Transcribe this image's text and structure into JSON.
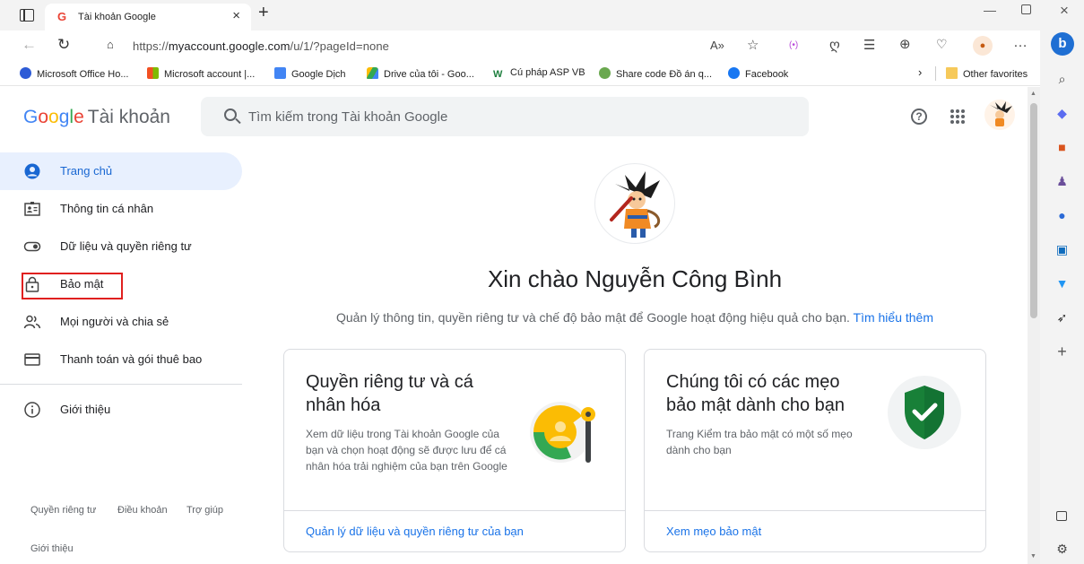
{
  "browser": {
    "tab_title": "Tài khoản Google",
    "tab_favicon": "G",
    "url_prefix": "https://",
    "url_domain": "myaccount.google.com",
    "url_path": "/u/1/?pageId=none",
    "new_tab_symbol": "+",
    "favorites": [
      {
        "label": "Microsoft Office Ho...",
        "icon": "office-icon",
        "color": "#2d5bd6"
      },
      {
        "label": "Microsoft account |...",
        "icon": "microsoft-icon",
        "color": "#f25022"
      },
      {
        "label": "Google Dịch",
        "icon": "translate-icon",
        "color": "#4285f4"
      },
      {
        "label": "Drive của tôi - Goo...",
        "icon": "drive-icon",
        "color": "#34a853"
      },
      {
        "label": "Cú pháp ASP VB",
        "icon": "w3-icon",
        "color": "#1d7f3e"
      },
      {
        "label": "Share code Đồ án q...",
        "icon": "share-code-icon",
        "color": "#6aa84f"
      },
      {
        "label": "Facebook",
        "icon": "facebook-icon",
        "color": "#1877f2"
      }
    ],
    "other_favorites": "Other favorites"
  },
  "header": {
    "logo_google": [
      "G",
      "o",
      "o",
      "g",
      "l",
      "e"
    ],
    "logo_account": "Tài khoản",
    "search_placeholder": "Tìm kiếm trong Tài khoản Google",
    "help_symbol": "?"
  },
  "nav": {
    "items": [
      {
        "label": "Trang chủ",
        "icon": "home-icon",
        "active": true
      },
      {
        "label": "Thông tin cá nhân",
        "icon": "id-card-icon"
      },
      {
        "label": "Dữ liệu và quyền riêng tư",
        "icon": "toggle-icon"
      },
      {
        "label": "Bảo mật",
        "icon": "lock-icon"
      },
      {
        "label": "Mọi người và chia sẻ",
        "icon": "people-icon"
      },
      {
        "label": "Thanh toán và gói thuê bao",
        "icon": "credit-card-icon"
      },
      {
        "label": "Giới thiệu",
        "icon": "info-icon"
      }
    ],
    "footer": {
      "privacy": "Quyền riêng tư",
      "terms": "Điều khoản",
      "help": "Trợ giúp",
      "about": "Giới thiệu"
    }
  },
  "main": {
    "greeting": "Xin chào Nguyễn Công Bình",
    "subtitle": "Quản lý thông tin, quyền riêng tư và chế độ bảo mật để Google hoạt động hiệu quả cho bạn.",
    "learn_more": "Tìm hiểu thêm",
    "cards": [
      {
        "title": "Quyền riêng tư và cá nhân hóa",
        "desc": "Xem dữ liệu trong Tài khoản Google của bạn và chọn hoạt động sẽ được lưu để cá nhân hóa trải nghiệm của bạn trên Google",
        "link": "Quản lý dữ liệu và quyền riêng tư của bạn"
      },
      {
        "title": "Chúng tôi có các mẹo bảo mật dành cho bạn",
        "desc": "Trang Kiểm tra bảo mật có một số mẹo dành cho bạn",
        "link": "Xem mẹo bảo mật"
      }
    ]
  },
  "colors": {
    "accent": "#1a73e8",
    "active_bg": "#e8f0fe",
    "highlight_border": "#e0201f",
    "shield": "#188038"
  }
}
